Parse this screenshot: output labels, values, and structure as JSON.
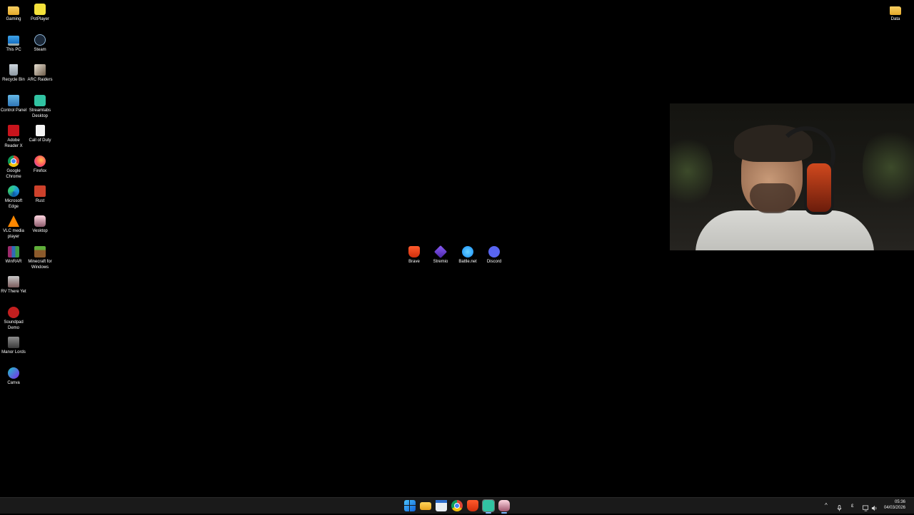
{
  "desktop": {
    "icons_left": [
      {
        "label": "Gaming",
        "icon": "folder-icon"
      },
      {
        "label": "PotPlayer",
        "icon": "potplayer-icon"
      },
      {
        "label": "This PC",
        "icon": "monitor-icon"
      },
      {
        "label": "Steam",
        "icon": "steam-icon"
      },
      {
        "label": "Recycle Bin",
        "icon": "recycle-bin-icon"
      },
      {
        "label": "ARC Raiders",
        "icon": "arc-raiders-icon"
      },
      {
        "label": "Control Panel",
        "icon": "control-panel-icon"
      },
      {
        "label": "Streamlabs Desktop",
        "icon": "streamlabs-icon"
      },
      {
        "label": "Adobe Reader X",
        "icon": "adobe-reader-icon"
      },
      {
        "label": "Call of Duty",
        "icon": "document-icon"
      },
      {
        "label": "Google Chrome",
        "icon": "chrome-icon"
      },
      {
        "label": "Firefox",
        "icon": "firefox-icon"
      },
      {
        "label": "Microsoft Edge",
        "icon": "edge-icon"
      },
      {
        "label": "Rust",
        "icon": "rust-icon"
      },
      {
        "label": "VLC media player",
        "icon": "vlc-icon"
      },
      {
        "label": "Vesktop",
        "icon": "vesktop-icon"
      },
      {
        "label": "WinRAR",
        "icon": "winrar-icon"
      },
      {
        "label": "Minecraft for Windows",
        "icon": "minecraft-icon"
      },
      {
        "label": "RV There Yet",
        "icon": "rv-there-yet-icon"
      },
      {
        "label": "Soundpad Demo",
        "icon": "soundpad-icon"
      },
      {
        "label": "Manor Lords",
        "icon": "manor-lords-icon"
      },
      {
        "label": "Canva",
        "icon": "canva-icon"
      }
    ],
    "icons_center": [
      {
        "label": "Brave",
        "icon": "brave-icon"
      },
      {
        "label": "Stremio",
        "icon": "stremio-icon"
      },
      {
        "label": "Battle.net",
        "icon": "battlenet-icon"
      },
      {
        "label": "Discord",
        "icon": "discord-icon"
      }
    ],
    "icon_right": {
      "label": "Data",
      "icon": "folder-icon"
    }
  },
  "taskbar": {
    "apps": [
      {
        "name": "start-button",
        "icon": "windows-icon"
      },
      {
        "name": "file-explorer",
        "icon": "folder-icon"
      },
      {
        "name": "calendar",
        "icon": "calendar-icon"
      },
      {
        "name": "google-chrome",
        "icon": "chrome-icon"
      },
      {
        "name": "brave",
        "icon": "brave-icon"
      },
      {
        "name": "streamlabs",
        "icon": "streamlabs-icon"
      },
      {
        "name": "vesktop",
        "icon": "vesktop-icon"
      }
    ],
    "tray": {
      "chevron": "^",
      "language": "ε",
      "time": "05:36",
      "date": "04/03/2026"
    }
  }
}
